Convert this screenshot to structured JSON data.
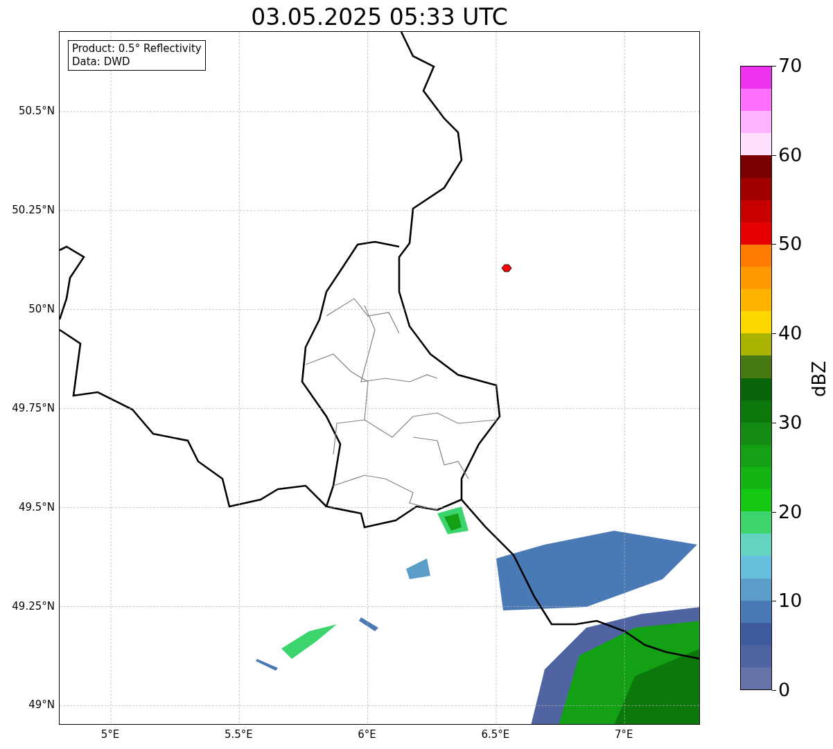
{
  "title": "03.05.2025 05:33 UTC",
  "legend": [
    "Product: 0.5° Reflectivity",
    "Data: DWD"
  ],
  "latitude_labels": [
    "50.5°N",
    "50.25°N",
    "50°N",
    "49.75°N",
    "49.5°N",
    "49.25°N",
    "49°N"
  ],
  "longitude_labels": [
    "5°E",
    "5.5°E",
    "6°E",
    "6.5°E",
    "7°E"
  ],
  "colorbar": {
    "label": "dBZ",
    "ticks": [
      "70",
      "60",
      "50",
      "40",
      "30",
      "20",
      "10",
      "0"
    ],
    "segments": [
      {
        "color": "#ee33ee"
      },
      {
        "color": "#ff6eff"
      },
      {
        "color": "#ffb4ff"
      },
      {
        "color": "#ffe0ff"
      },
      {
        "color": "#780000"
      },
      {
        "color": "#a00000"
      },
      {
        "color": "#c80000"
      },
      {
        "color": "#e60000"
      },
      {
        "color": "#ff7c00"
      },
      {
        "color": "#ff9900"
      },
      {
        "color": "#ffb400"
      },
      {
        "color": "#ffd700"
      },
      {
        "color": "#aab400"
      },
      {
        "color": "#467814"
      },
      {
        "color": "#0a640a"
      },
      {
        "color": "#0c780c"
      },
      {
        "color": "#148c14"
      },
      {
        "color": "#14a014"
      },
      {
        "color": "#14b414"
      },
      {
        "color": "#14c814"
      },
      {
        "color": "#3cd46c"
      },
      {
        "color": "#64d4c0"
      },
      {
        "color": "#64c0dc"
      },
      {
        "color": "#5a9dc8"
      },
      {
        "color": "#4a7ab5"
      },
      {
        "color": "#3f5ba0"
      },
      {
        "color": "#4f64a0"
      },
      {
        "color": "#6474a8"
      }
    ]
  }
}
